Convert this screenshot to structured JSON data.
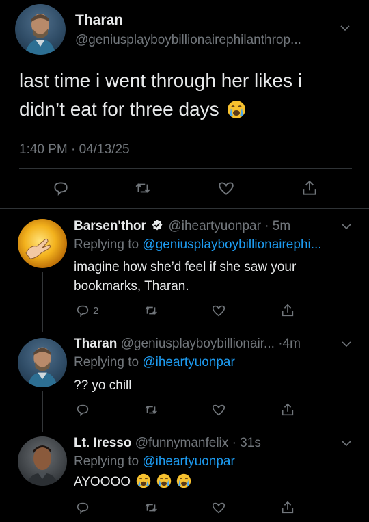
{
  "main_tweet": {
    "name": "Tharan",
    "handle": "@geniusplayboybillionairephilanthrop...",
    "text_line1": "last time i went through her likes i",
    "text_line2": "didn’t eat for three days",
    "timestamp": "1:40 PM · 04/13/25"
  },
  "replies": [
    {
      "name": "Barsen'thor",
      "handle": "@iheartyuonpar",
      "time": "· 5m",
      "replying_prefix": "Replying to",
      "replying_to": "@geniusplayboybillionairephi...",
      "text_line1": "imagine how she’d feel if she saw your",
      "text_line2": "bookmarks, Tharan.",
      "reply_count": "2"
    },
    {
      "name": "Tharan",
      "handle": "@geniusplayboybillionair...",
      "time": "·4m",
      "replying_prefix": "Replying to",
      "replying_to": "@iheartyuonpar",
      "text_line1": "?? yo chill"
    },
    {
      "name": "Lt. Iresso",
      "handle": "@funnymanfelix",
      "time": "· 31s",
      "replying_prefix": "Replying to",
      "replying_to": "@iheartyuonpar",
      "text_line1": "AYOOOO"
    }
  ],
  "colors": {
    "background": "#000000",
    "text": "#e7e9ea",
    "muted": "#71767b",
    "link": "#1d9bf0",
    "divider": "#2f3336"
  },
  "icons": [
    "reply-icon",
    "retweet-icon",
    "like-icon",
    "share-icon",
    "chevron-down-icon",
    "verified-badge-icon",
    "crying-emoji-icon"
  ]
}
